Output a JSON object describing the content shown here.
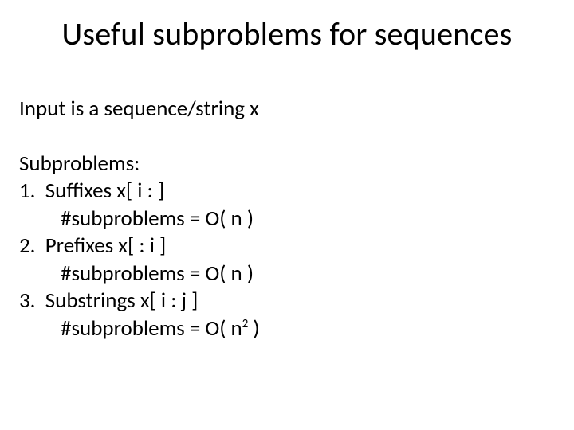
{
  "title": "Useful subproblems for sequences",
  "intro": "Input is a sequence/string x",
  "subhead": "Subproblems:",
  "items": [
    {
      "num": "1.",
      "def": "Suffixes x[ i : ]",
      "count_pre": "#subproblems = O( n",
      "exp": "",
      "count_post": " )"
    },
    {
      "num": "2.",
      "def": "Prefixes x[ : i ]",
      "count_pre": "#subproblems = O( n",
      "exp": "",
      "count_post": " )"
    },
    {
      "num": "3.",
      "def": "Substrings x[ i : j ]",
      "count_pre": "#subproblems = O( n",
      "exp": "2",
      "count_post": " )"
    }
  ]
}
